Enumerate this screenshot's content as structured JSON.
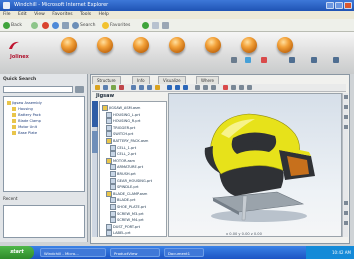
{
  "window": {
    "title": "Windchill - Microsoft Internet Explorer"
  },
  "menu": [
    "File",
    "Edit",
    "View",
    "Favorites",
    "Tools",
    "Help"
  ],
  "nav": {
    "back_label": "Back",
    "search_label": "Search",
    "favorites_label": "Favorites"
  },
  "brand": {
    "logo_text": "Jolinex"
  },
  "header_tabs": [
    "Home",
    "Products",
    "Projects",
    "Libraries",
    "Change",
    "Search",
    "Admin"
  ],
  "header_tools": [
    "Search",
    "Print",
    "Help",
    "Logout"
  ],
  "left_pane": {
    "title": "Quick Search",
    "tree": [
      "Jigsaw Assembly",
      "  Housing",
      "  Battery Pack",
      "  Blade Clamp",
      "  Motor Unit",
      "  Base Plate"
    ],
    "sub_title": "Recent"
  },
  "viewer": {
    "tabs": [
      "Structure",
      "Info",
      "Visualize",
      "Where"
    ],
    "heading": "Jigsaw",
    "tree_rows": [
      "JIGSAW_ASM.asm",
      "HOUSING_L.prt",
      "HOUSING_R.prt",
      "TRIGGER.prt",
      "SWITCH.prt",
      "BATTERY_PACK.asm",
      "CELL_1.prt",
      "CELL_2.prt",
      "MOTOR.asm",
      "ARMATURE.prt",
      "BRUSH.prt",
      "GEAR_HOUSING.prt",
      "SPINDLE.prt",
      "BLADE_CLAMP.asm",
      "BLADE.prt",
      "SHOE_PLATE.prt",
      "SCREW_M3.prt",
      "SCREW_M4.prt",
      "DUST_PORT.prt",
      "LABEL.prt"
    ],
    "coord_label": "x 0.00  y 0.00  z 0.00"
  },
  "taskbar": {
    "start_label": "start",
    "tasks": [
      "Windchill - Micro...",
      "ProductView",
      "Document1"
    ],
    "clock": "10:42 AM"
  },
  "colors": {
    "model_body": "#e7e21a",
    "model_dark": "#2f3135",
    "model_accent": "#c7701c",
    "orb": "#f3a23a"
  }
}
